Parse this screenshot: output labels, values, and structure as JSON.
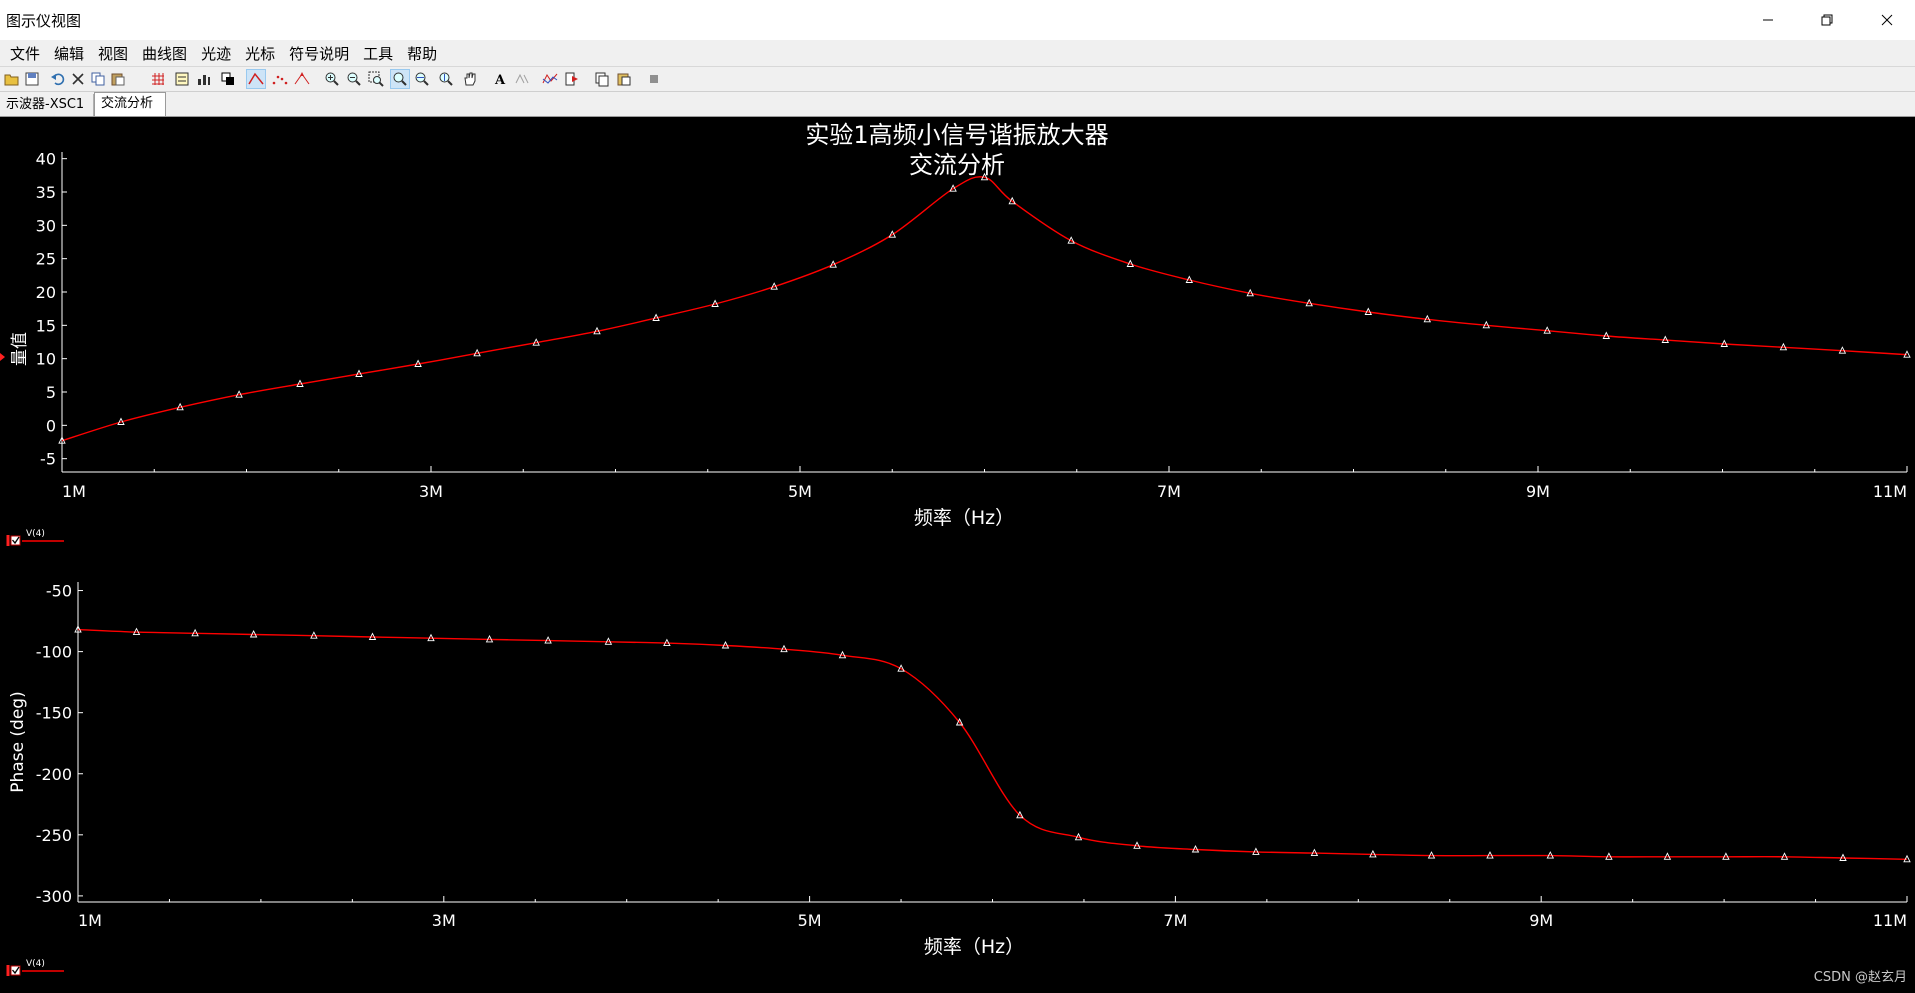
{
  "window": {
    "title": "图示仪视图"
  },
  "menu": [
    "文件",
    "编辑",
    "视图",
    "曲线图",
    "光迹",
    "光标",
    "符号说明",
    "工具",
    "帮助"
  ],
  "tabs": [
    "示波器-XSC1",
    "交流分析"
  ],
  "toolbar_icons": [
    "open-icon",
    "save-icon",
    "undo-icon",
    "cut-icon",
    "copy-icon",
    "paste-icon",
    "grid-icon",
    "legend-icon",
    "bars-icon",
    "overlay-icon",
    "trace-line-icon",
    "trace-dots-icon",
    "trace-marker-icon",
    "zoom-in-icon",
    "zoom-out-icon",
    "zoom-area-icon",
    "zoom-full-icon",
    "zoom-x-icon",
    "zoom-y-icon",
    "pan-icon",
    "text-icon",
    "format-icon",
    "select-trace-icon",
    "export-icon",
    "copy-graph-icon",
    "paste-graph-icon",
    "stop-icon"
  ],
  "watermark": "CSDN @赵玄月",
  "colors": {
    "background": "#000000",
    "trace": "#ff0000",
    "marker": "#ffffff",
    "axis": "#ffffff"
  },
  "chart_data": [
    {
      "type": "line",
      "title": "实验1高频小信号谐振放大器",
      "subtitle": "交流分析",
      "xlabel": "频率（Hz）",
      "ylabel": "量值",
      "xlim": [
        1000000,
        11000000
      ],
      "ylim": [
        -7,
        41
      ],
      "xticks": [
        1000000,
        3000000,
        5000000,
        7000000,
        9000000,
        11000000
      ],
      "xtick_labels": [
        "1M",
        "3M",
        "5M",
        "7M",
        "9M",
        "11M"
      ],
      "yticks": [
        -5,
        0,
        5,
        10,
        15,
        20,
        25,
        30,
        35,
        40
      ],
      "ytick_labels": [
        "-5",
        "0",
        "5",
        "10",
        "15",
        "20",
        "25",
        "30",
        "35",
        "40"
      ],
      "legend": "bottom-left",
      "series": [
        {
          "name": "V(4)",
          "x": [
            1000000,
            1320000,
            1640000,
            1960000,
            2290000,
            2610000,
            2930000,
            3250000,
            3570000,
            3900000,
            4220000,
            4540000,
            4860000,
            5180000,
            5500000,
            5830000,
            6000000,
            6150000,
            6470000,
            6790000,
            7110000,
            7440000,
            7760000,
            8080000,
            8400000,
            8720000,
            9050000,
            9370000,
            9690000,
            10010000,
            10330000,
            10650000,
            11000000
          ],
          "values": [
            -2.3,
            0.5,
            2.7,
            4.6,
            6.2,
            7.7,
            9.2,
            10.8,
            12.4,
            14.1,
            16.1,
            18.2,
            20.8,
            24.1,
            28.6,
            35.5,
            37.2,
            33.6,
            27.7,
            24.2,
            21.8,
            19.8,
            18.3,
            17.0,
            15.9,
            15.0,
            14.2,
            13.4,
            12.8,
            12.2,
            11.7,
            11.2,
            10.6
          ]
        }
      ]
    },
    {
      "type": "line",
      "xlabel": "频率（Hz）",
      "ylabel": "Phase (deg)",
      "xlim": [
        1000000,
        11000000
      ],
      "ylim": [
        -305,
        -43
      ],
      "xticks": [
        1000000,
        3000000,
        5000000,
        7000000,
        9000000,
        11000000
      ],
      "xtick_labels": [
        "1M",
        "3M",
        "5M",
        "7M",
        "9M",
        "11M"
      ],
      "yticks": [
        -50,
        -100,
        -150,
        -200,
        -250,
        -300
      ],
      "ytick_labels": [
        "-50",
        "-100",
        "-150",
        "-200",
        "-250",
        "-300"
      ],
      "legend": "bottom-left",
      "series": [
        {
          "name": "V(4)",
          "x": [
            1000000,
            1320000,
            1640000,
            1960000,
            2290000,
            2610000,
            2930000,
            3250000,
            3570000,
            3900000,
            4220000,
            4540000,
            4860000,
            5180000,
            5500000,
            5820000,
            6150000,
            6470000,
            6790000,
            7110000,
            7440000,
            7760000,
            8080000,
            8400000,
            8720000,
            9050000,
            9370000,
            9690000,
            10010000,
            10330000,
            10650000,
            11000000
          ],
          "values": [
            -82,
            -84,
            -85,
            -86,
            -87,
            -88,
            -89,
            -90,
            -91,
            -92,
            -93,
            -95,
            -98,
            -103,
            -114,
            -158,
            -234,
            -252,
            -259,
            -262,
            -264,
            -265,
            -266,
            -267,
            -267,
            -267,
            -268,
            -268,
            -268,
            -268,
            -269,
            -270
          ]
        }
      ]
    }
  ]
}
